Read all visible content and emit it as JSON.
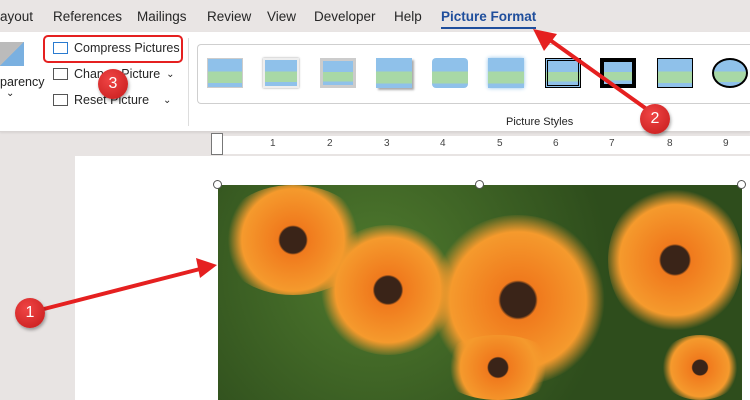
{
  "tabs": [
    "ayout",
    "References",
    "Mailings",
    "Review",
    "View",
    "Developer",
    "Help",
    "Picture Format"
  ],
  "active_tab": "Picture Format",
  "ribbon": {
    "transparency_label": "parency",
    "compress_pictures": "Compress Pictures",
    "change_picture": "Change Picture",
    "reset_picture": "Reset Picture",
    "group_label": "Picture Styles"
  },
  "ruler": [
    "1",
    "2",
    "3",
    "4",
    "5",
    "6",
    "7",
    "8",
    "9"
  ],
  "annotations": [
    "1",
    "2",
    "3"
  ],
  "colors": {
    "accent": "#1f4e9c",
    "annotation": "#e52020"
  }
}
